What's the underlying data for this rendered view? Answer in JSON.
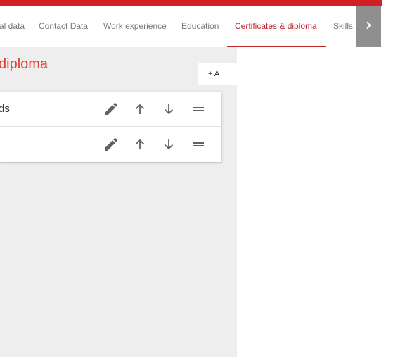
{
  "tabs": [
    {
      "label": "al data"
    },
    {
      "label": "Contact Data"
    },
    {
      "label": "Work experience"
    },
    {
      "label": "Education"
    },
    {
      "label": "Certificates & diploma"
    },
    {
      "label": "Skills"
    }
  ],
  "active_tab": "Certificates & diploma",
  "section": {
    "title": "diploma",
    "add_label": "+ A"
  },
  "items": [
    {
      "label": "ds"
    },
    {
      "label": ""
    }
  ],
  "icons": {
    "next": "chevron-right-icon",
    "edit": "pencil-icon",
    "up": "arrow-up-icon",
    "down": "arrow-down-icon",
    "drag": "drag-handle-icon"
  },
  "colors": {
    "brand_red": "#d21f24",
    "active_tab": "#c0272d",
    "title_red": "#e53935",
    "background": "#eeeeee"
  }
}
